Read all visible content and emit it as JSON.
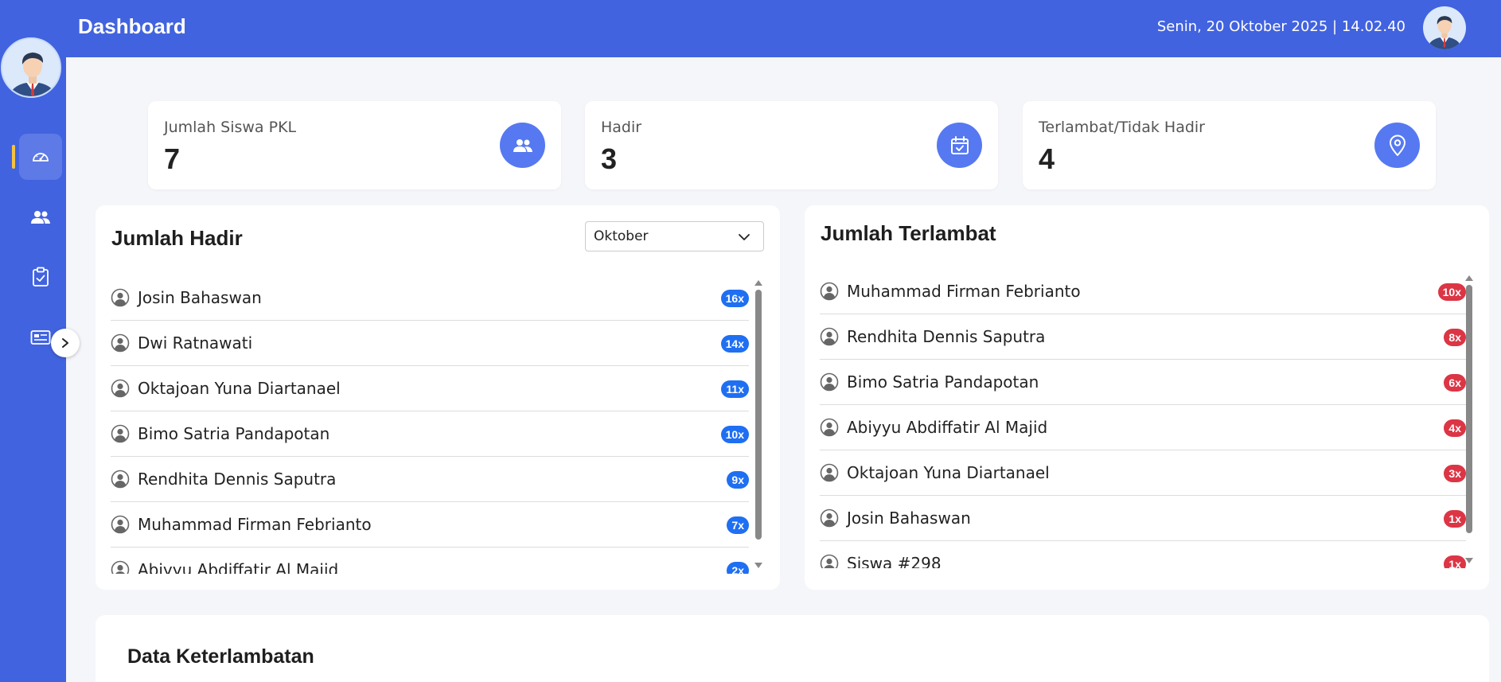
{
  "header": {
    "title": "Dashboard",
    "datetime": "Senin, 20 Oktober 2025 | 14.02.40"
  },
  "sidebar": {
    "items": [
      {
        "icon": "dashboard-gauge-icon",
        "active": true
      },
      {
        "icon": "users-icon",
        "active": false
      },
      {
        "icon": "clipboard-check-icon",
        "active": false
      },
      {
        "icon": "id-card-icon",
        "active": false
      }
    ],
    "collapse_icon": "chevron-right-icon"
  },
  "stats": [
    {
      "label": "Jumlah Siswa PKL",
      "value": "7",
      "icon": "users-icon"
    },
    {
      "label": "Hadir",
      "value": "3",
      "icon": "calendar-check-icon"
    },
    {
      "label": "Terlambat/Tidak Hadir",
      "value": "4",
      "icon": "location-pin-icon"
    }
  ],
  "hadir": {
    "title": "Jumlah Hadir",
    "month_selected": "Oktober",
    "rows": [
      {
        "name": "Josin Bahaswan",
        "count": "16x"
      },
      {
        "name": "Dwi Ratnawati",
        "count": "14x"
      },
      {
        "name": "Oktajoan Yuna Diartanael",
        "count": "11x"
      },
      {
        "name": "Bimo Satria Pandapotan",
        "count": "10x"
      },
      {
        "name": "Rendhita Dennis Saputra",
        "count": "9x"
      },
      {
        "name": "Muhammad Firman Febrianto",
        "count": "7x"
      },
      {
        "name": "Abiyyu Abdiffatir Al Majid",
        "count": "2x"
      }
    ]
  },
  "terlambat": {
    "title": "Jumlah Terlambat",
    "rows": [
      {
        "name": "Muhammad Firman Febrianto",
        "count": "10x"
      },
      {
        "name": "Rendhita Dennis Saputra",
        "count": "8x"
      },
      {
        "name": "Bimo Satria Pandapotan",
        "count": "6x"
      },
      {
        "name": "Abiyyu Abdiffatir Al Majid",
        "count": "4x"
      },
      {
        "name": "Oktajoan Yuna Diartanael",
        "count": "3x"
      },
      {
        "name": "Josin Bahaswan",
        "count": "1x"
      },
      {
        "name": "Siswa #298",
        "count": "1x"
      }
    ]
  },
  "data_keterlambatan": {
    "title": "Data Keterlambatan"
  },
  "colors": {
    "primary": "#4263df",
    "badge_blue": "#1f6ff2",
    "badge_red": "#dc3545",
    "accent_indicator": "#f5c242"
  }
}
